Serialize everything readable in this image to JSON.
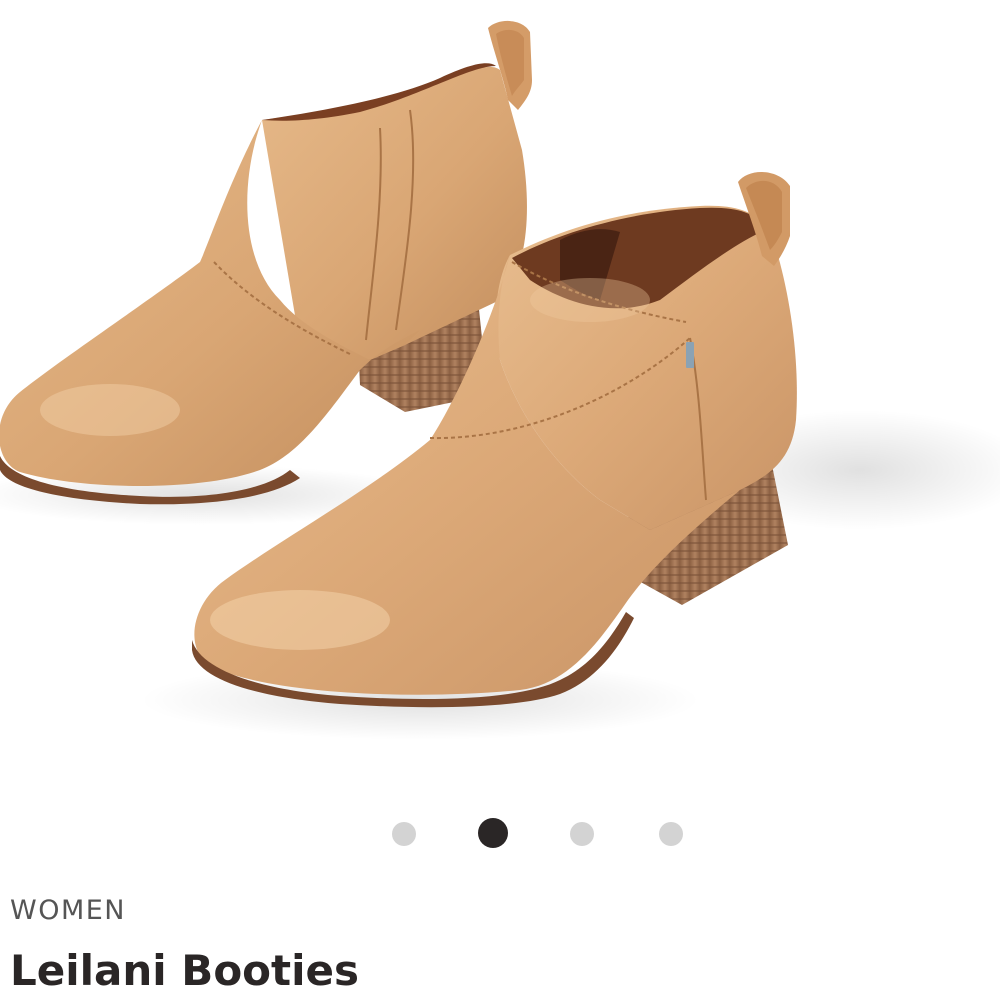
{
  "product": {
    "category": "WOMEN",
    "name": "Leilani Booties",
    "image_subject": "tan-leather-ankle-booties",
    "leather_color": "#D9A674",
    "heel_color": "#9E7050"
  },
  "carousel": {
    "slide_count": 4,
    "active_index": 1,
    "active_dot_color": "#2A2626",
    "inactive_dot_color": "#D3D3D3"
  }
}
